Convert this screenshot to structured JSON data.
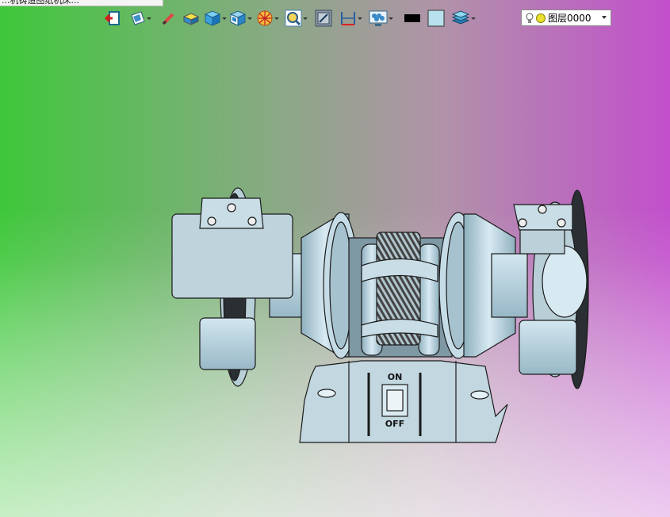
{
  "window": {
    "tab_title": "...机铸造图纸机床..."
  },
  "toolbar": {
    "buttons": [
      {
        "icon": "exit-icon",
        "dropdown": false
      },
      {
        "icon": "view-orient-icon",
        "dropdown": true
      },
      {
        "icon": "sketch-pencil-icon",
        "dropdown": false
      },
      {
        "icon": "shaded-box-icon",
        "dropdown": false
      },
      {
        "icon": "solid-cube-icon",
        "dropdown": true
      },
      {
        "icon": "view-cube-icon",
        "dropdown": true
      },
      {
        "icon": "render-sphere-icon",
        "dropdown": true
      },
      {
        "icon": "zoom-window-icon",
        "dropdown": true
      },
      {
        "icon": "section-view-icon",
        "dropdown": false
      },
      {
        "icon": "measure-dimension-icon",
        "dropdown": true
      },
      {
        "icon": "display-settings-icon",
        "dropdown": true
      },
      {
        "icon": "color-black-swatch-icon",
        "dropdown": false
      },
      {
        "icon": "color-light-blue-swatch-icon",
        "dropdown": false
      },
      {
        "icon": "layers-icon",
        "dropdown": true
      }
    ],
    "swatch_black": "#000000",
    "swatch_lightblue": "#b8e0ee"
  },
  "layer": {
    "name": "图层0000"
  },
  "model": {
    "switch_on": "ON",
    "switch_off": "OFF",
    "body_color": "#b9d4df",
    "edge_color": "#1a1a1a"
  },
  "viewport": {
    "gradient_left": "#3ec73a",
    "gradient_right": "#c24fcc"
  }
}
